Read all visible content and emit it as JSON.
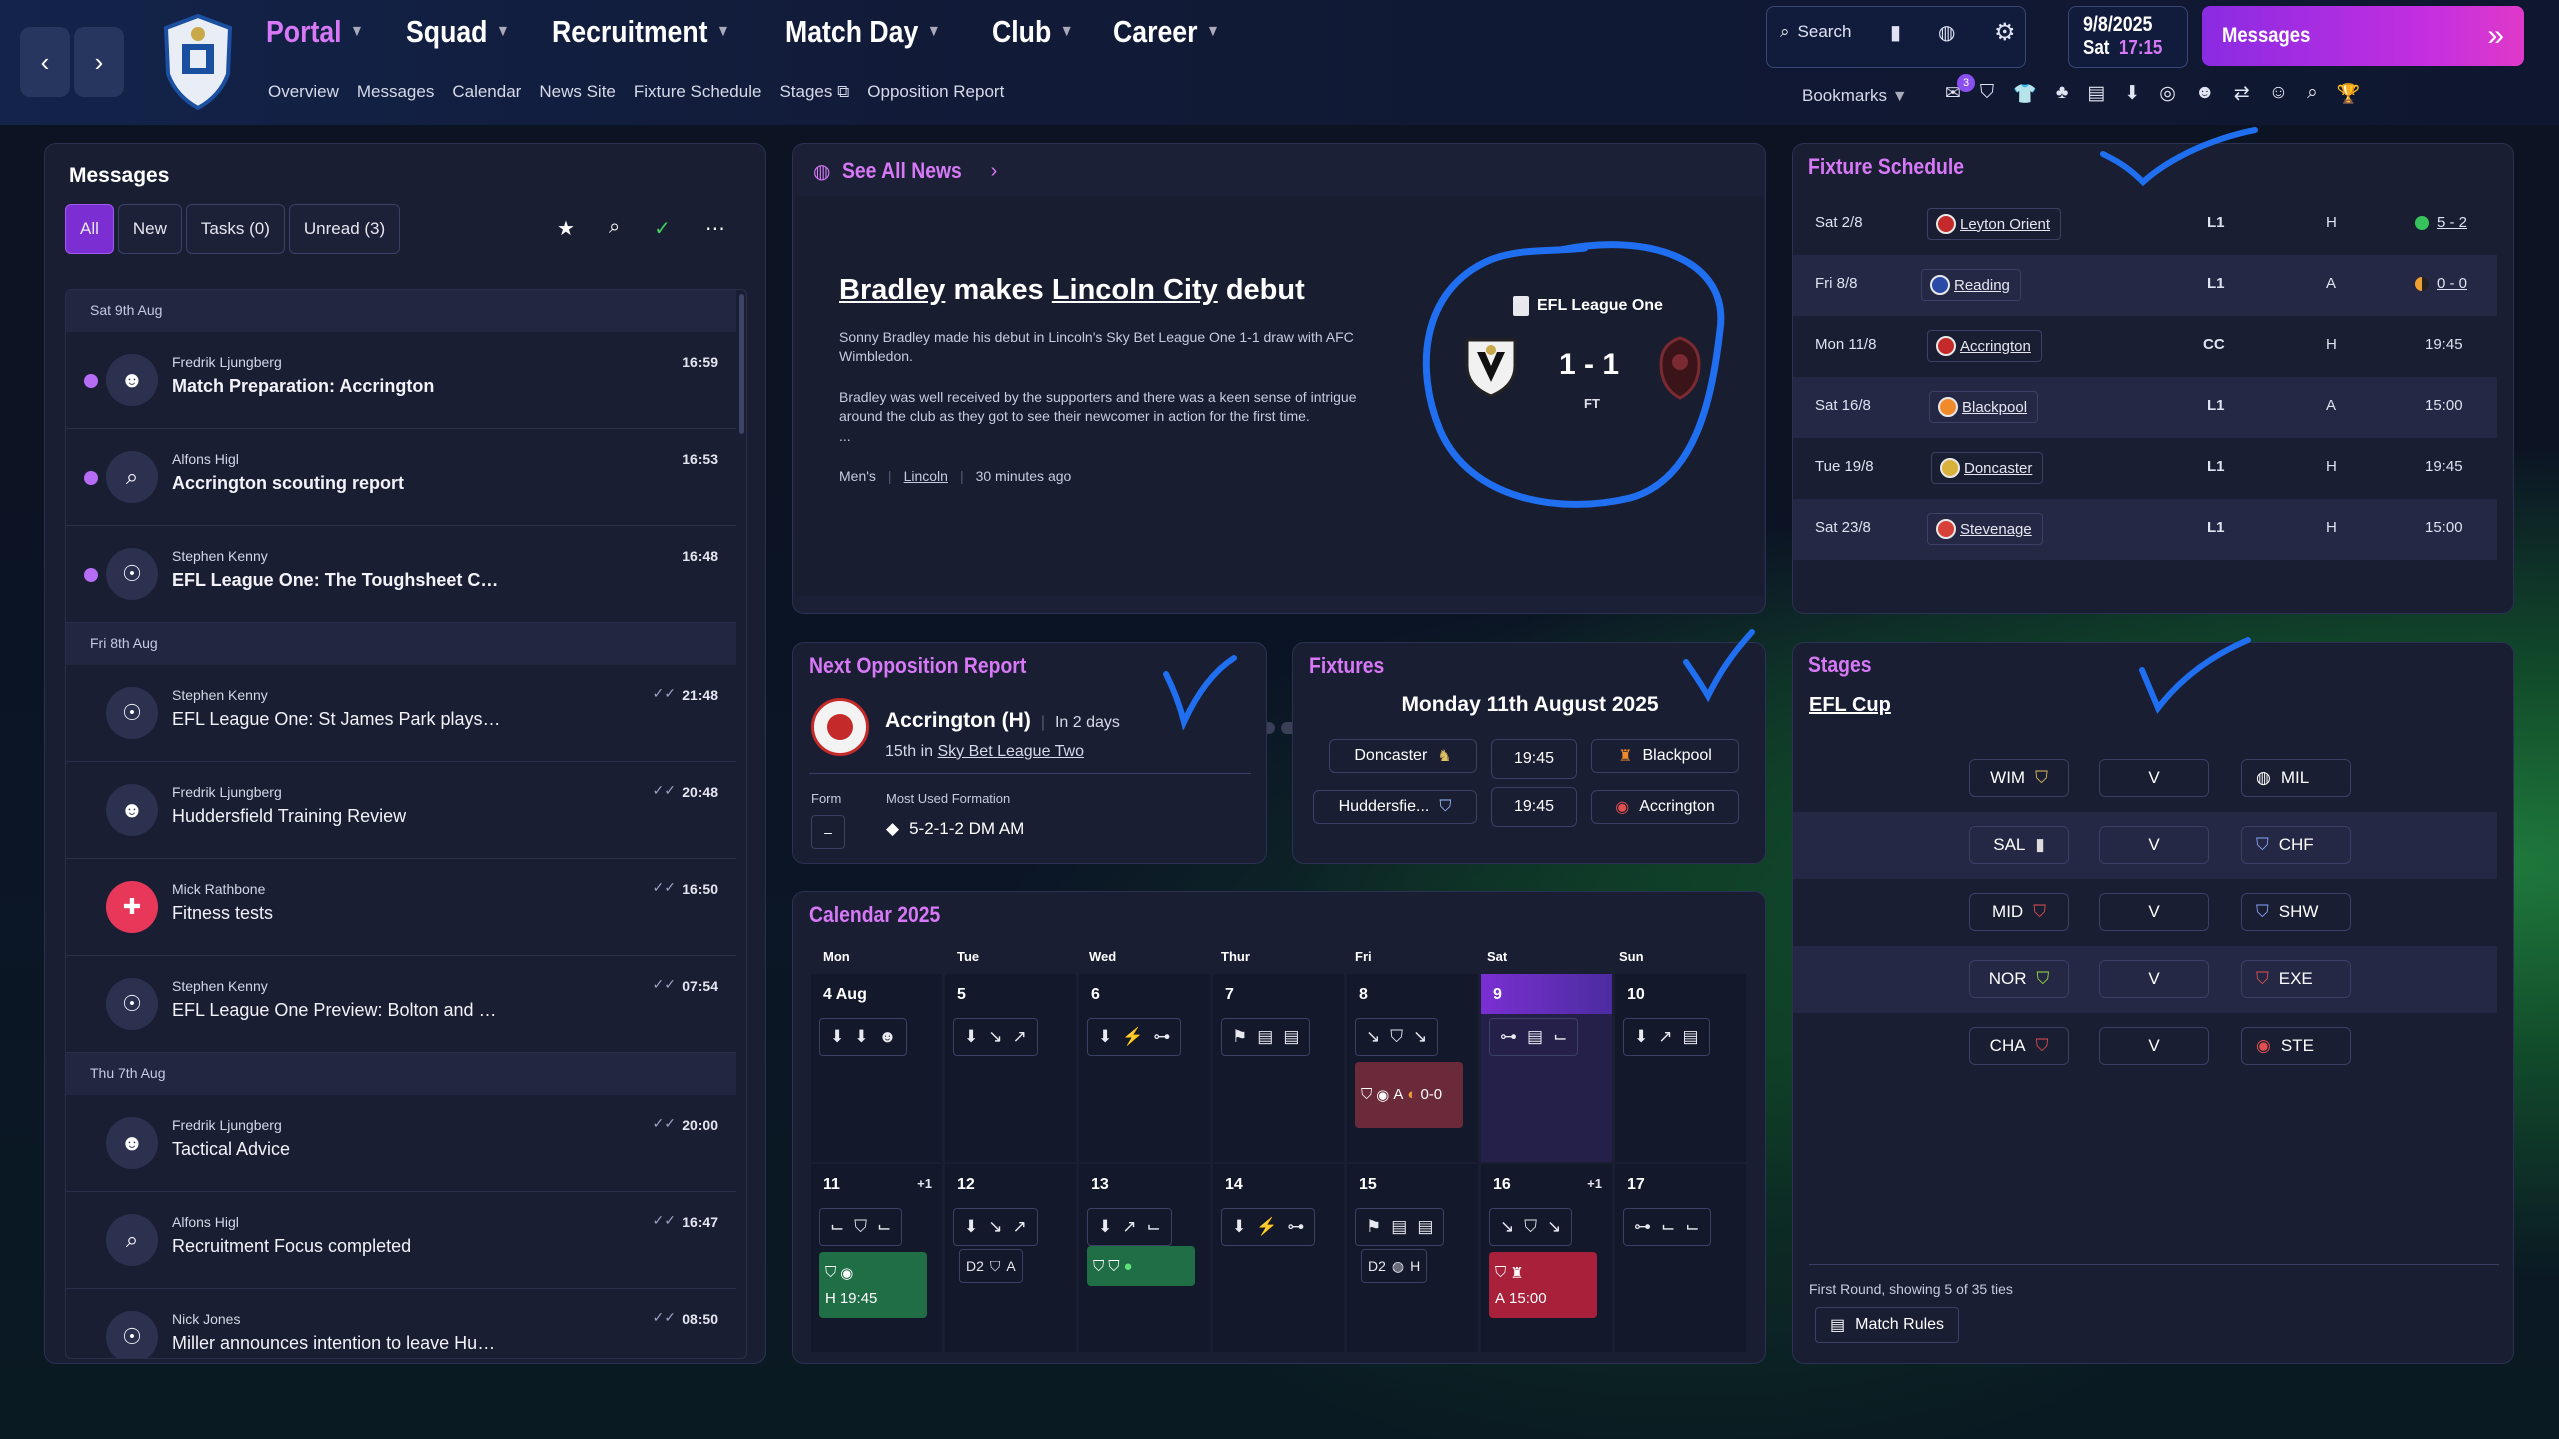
{
  "nav": {
    "items": [
      {
        "label": "Portal"
      },
      {
        "label": "Squad"
      },
      {
        "label": "Recruitment"
      },
      {
        "label": "Match Day"
      },
      {
        "label": "Club"
      },
      {
        "label": "Career"
      }
    ],
    "sub": [
      "Overview",
      "Messages",
      "Calendar",
      "News Site",
      "Fixture Schedule",
      "Stages",
      "Opposition Report"
    ],
    "search": "Search",
    "date": "9/8/2025",
    "day": "Sat",
    "time": "17:15",
    "messages_btn": "Messages",
    "bookmarks": "Bookmarks",
    "notif_count": "3"
  },
  "messages": {
    "title": "Messages",
    "filters": [
      "All",
      "New",
      "Tasks (0)",
      "Unread (3)"
    ],
    "groups": [
      {
        "date": "Sat 9th Aug",
        "items": [
          {
            "from": "Fredrik Ljungberg",
            "subject": "Match Preparation: Accrington",
            "time": "16:59"
          },
          {
            "from": "Alfons Higl",
            "subject": "Accrington scouting report",
            "time": "16:53"
          },
          {
            "from": "Stephen Kenny",
            "subject": "EFL League One: The Toughsheet Community Stadium play...",
            "time": "16:48"
          }
        ]
      },
      {
        "date": "Fri 8th Aug",
        "items": [
          {
            "from": "Stephen Kenny",
            "subject": "EFL League One: St James Park plays host to memorable match",
            "time": "21:48"
          },
          {
            "from": "Fredrik Ljungberg",
            "subject": "Huddersfield Training Review",
            "time": "20:48"
          },
          {
            "from": "Mick Rathbone",
            "subject": "Fitness tests",
            "time": "16:50"
          },
          {
            "from": "Stephen Kenny",
            "subject": "EFL League One Preview: Bolton and Plymouth provide top billing",
            "time": "07:54"
          }
        ]
      },
      {
        "date": "Thu 7th Aug",
        "items": [
          {
            "from": "Fredrik Ljungberg",
            "subject": "Tactical Advice",
            "time": "20:00"
          },
          {
            "from": "Alfons Higl",
            "subject": "Recruitment Focus completed",
            "time": "16:47"
          },
          {
            "from": "Nick Jones",
            "subject": "Miller announces intention to leave Huddersfield",
            "time": "08:50"
          }
        ]
      }
    ]
  },
  "news": {
    "link": "See All News",
    "headline_1": "Bradley",
    "headline_2": " makes ",
    "headline_3": "Lincoln City",
    "headline_4": " debut",
    "p1": "Sonny Bradley made his debut in Lincoln's Sky Bet League One 1-1 draw with AFC Wimbledon.",
    "p2": "Bradley was well received by the supporters and there was a keen sense of intrigue around the club as they got to see their newcomer in action for the first time.",
    "ellipsis": "...",
    "tag1": "Men's",
    "tag2": "Lincoln",
    "ago": "30 minutes ago",
    "comp": "EFL League One",
    "score": "1 - 1",
    "status": "FT"
  },
  "schedule": {
    "title": "Fixture Schedule",
    "rows": [
      {
        "date": "Sat 2/8",
        "team": "Leyton Orient",
        "comp": "L1",
        "venue": "H",
        "result": "5 - 2",
        "res_color": "#37c35b"
      },
      {
        "date": "Fri 8/8",
        "team": "Reading",
        "comp": "L1",
        "venue": "A",
        "result": "0 - 0",
        "res_color": "#f0a030"
      },
      {
        "date": "Mon 11/8",
        "team": "Accrington",
        "comp": "CC",
        "venue": "H",
        "result": "19:45"
      },
      {
        "date": "Sat 16/8",
        "team": "Blackpool",
        "comp": "L1",
        "venue": "A",
        "result": "15:00"
      },
      {
        "date": "Tue 19/8",
        "team": "Doncaster",
        "comp": "L1",
        "venue": "H",
        "result": "19:45"
      },
      {
        "date": "Sat 23/8",
        "team": "Stevenage",
        "comp": "L1",
        "venue": "H",
        "result": "15:00"
      }
    ]
  },
  "opp": {
    "title": "Next Opposition Report",
    "team": "Accrington (H)",
    "when": "In 2 days",
    "pos": "15th in",
    "league": "Sky Bet League Two",
    "form_label": "Form",
    "form_val": "–",
    "formation_label": "Most Used Formation",
    "formation": "5-2-1-2 DM AM"
  },
  "fixtures": {
    "title": "Fixtures",
    "date": "Monday 11th August 2025",
    "rows": [
      {
        "home": "Doncaster",
        "time": "19:45",
        "away": "Blackpool"
      },
      {
        "home": "Huddersfie...",
        "time": "19:45",
        "away": "Accrington"
      }
    ]
  },
  "calendar": {
    "title": "Calendar 2025",
    "days": [
      "Mon",
      "Tue",
      "Wed",
      "Thur",
      "Fri",
      "Sat",
      "Sun"
    ],
    "week1": [
      "4 Aug",
      "5",
      "6",
      "7",
      "8",
      "9",
      "10"
    ],
    "week2": [
      "11",
      "12",
      "13",
      "14",
      "15",
      "16",
      "17"
    ],
    "plus1": "+1",
    "fri_venue": "A",
    "fri_score": "0-0",
    "mon_venue": "H",
    "mon_time": "19:45",
    "tue_comp": "D2",
    "tue_venue": "A",
    "fri2_comp": "D2",
    "fri2_venue": "H",
    "sat_venue": "A",
    "sat_time": "15:00"
  },
  "stages": {
    "title": "Stages",
    "cup": "EFL Cup",
    "vs": "V",
    "ties": [
      {
        "home": "WIM",
        "away": "MIL"
      },
      {
        "home": "SAL",
        "away": "CHF"
      },
      {
        "home": "MID",
        "away": "SHW"
      },
      {
        "home": "NOR",
        "away": "EXE"
      },
      {
        "home": "CHA",
        "away": "STE"
      }
    ],
    "footer": "First Round, showing 5 of 35 ties",
    "rules": "Match Rules"
  },
  "colors": {
    "accent": "#d779f6",
    "active": "#7b2fd3",
    "scribble": "#1f6ff0"
  }
}
